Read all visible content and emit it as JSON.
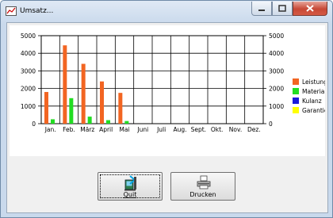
{
  "window": {
    "title": "Umsatz..."
  },
  "buttons": {
    "quit_label": "Quit",
    "print_label": "Drucken"
  },
  "colors": {
    "leistung": "#f26522",
    "material": "#22dd22",
    "kulanz": "#1a1adb",
    "garantie": "#ffff00"
  },
  "chart_data": {
    "type": "bar",
    "categories": [
      "Jan.",
      "Feb.",
      "März",
      "April",
      "Mai",
      "Juni",
      "Juli",
      "Aug.",
      "Sept.",
      "Okt.",
      "Nov.",
      "Dez."
    ],
    "series": [
      {
        "name": "Leistung",
        "values": [
          1800,
          4450,
          3400,
          2400,
          1750,
          0,
          0,
          0,
          0,
          0,
          0,
          0
        ]
      },
      {
        "name": "Material",
        "values": [
          250,
          1450,
          400,
          200,
          150,
          0,
          0,
          0,
          0,
          0,
          0,
          0
        ]
      },
      {
        "name": "Kulanz",
        "values": [
          0,
          0,
          0,
          0,
          0,
          0,
          0,
          0,
          0,
          0,
          0,
          0
        ]
      },
      {
        "name": "Garantie",
        "values": [
          0,
          0,
          0,
          0,
          0,
          0,
          0,
          0,
          0,
          0,
          0,
          0
        ]
      }
    ],
    "ylim": [
      0,
      5000
    ],
    "yticks": [
      0,
      1000,
      2000,
      3000,
      4000,
      5000
    ],
    "grid": true,
    "legend": "right"
  }
}
